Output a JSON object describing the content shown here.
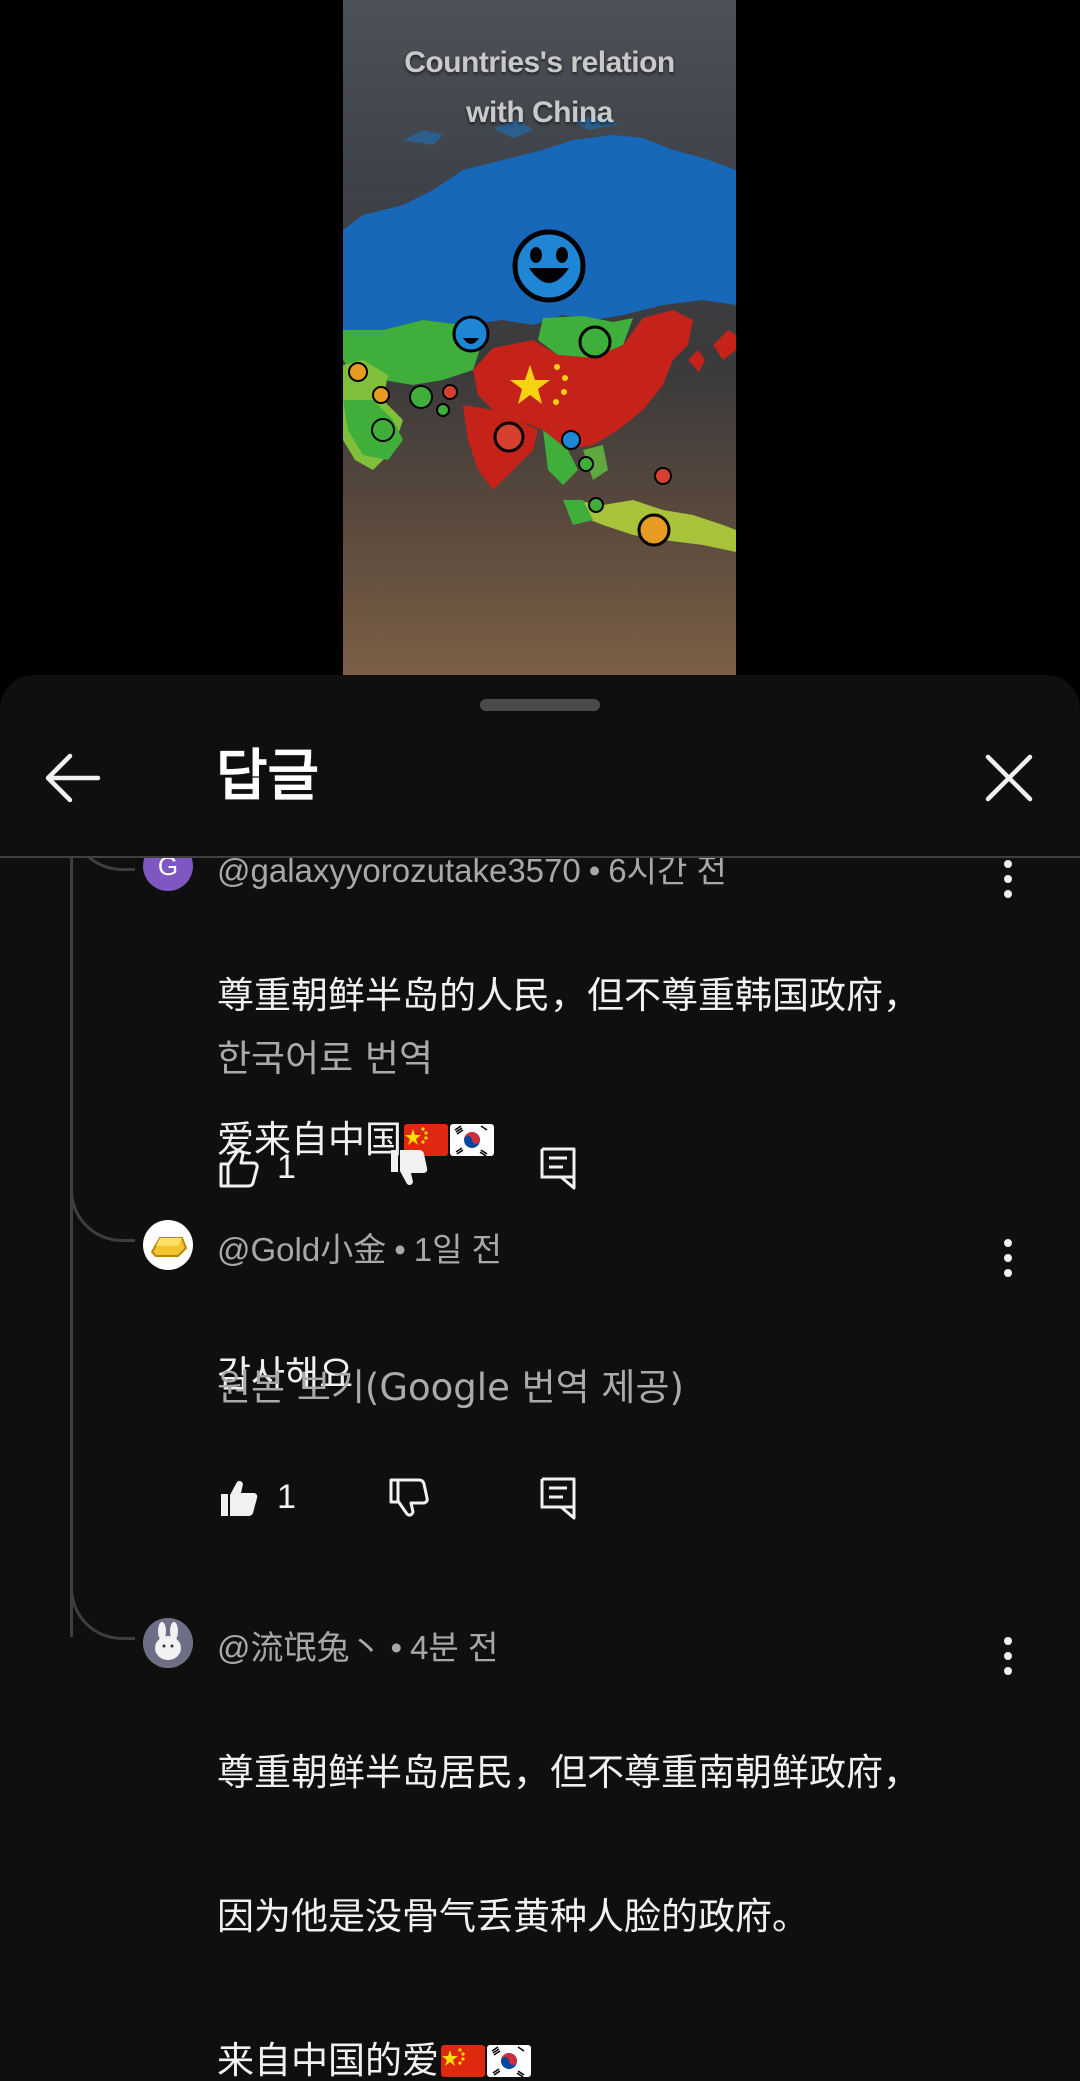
{
  "video": {
    "title_line1": "Countries's relation",
    "title_line2": "with China"
  },
  "header": {
    "title": "답글",
    "back_icon": "arrow-left-icon",
    "close_icon": "close-icon"
  },
  "comments": [
    {
      "avatar_letter": "G",
      "avatar_color": "#7e57c2",
      "author": "@galaxyyorozutake3570",
      "time": "6시간 전",
      "lines": [
        "尊重朝鲜半岛的人民，但不尊重韩国政府，",
        "爱来自中国"
      ],
      "flags": [
        "china-flag-icon",
        "south-korea-flag-icon"
      ],
      "translate": "한국어로 번역",
      "likes": "1",
      "disliked": true,
      "liked": false
    },
    {
      "avatar_icon": "gold-bar-icon",
      "author": "@Gold小金",
      "time": "1일 전",
      "lines": [
        "감사해요"
      ],
      "translate": "원본 보기(Google 번역 제공)",
      "likes": "1",
      "liked": true,
      "disliked": false
    },
    {
      "avatar_icon": "rabbit-avatar-icon",
      "author": "@流氓兔丶",
      "time": "4분 전",
      "lines": [
        "尊重朝鲜半岛居民，但不尊重南朝鲜政府，",
        "因为他是没骨气丢黄种人脸的政府。",
        "来自中国的爱"
      ],
      "flags": [
        "china-flag-icon",
        "south-korea-flag-icon"
      ]
    }
  ],
  "colors": {
    "sheet_bg": "#0f0f0f",
    "text_primary": "#f1f1f1",
    "text_secondary": "#aaaaaa"
  }
}
